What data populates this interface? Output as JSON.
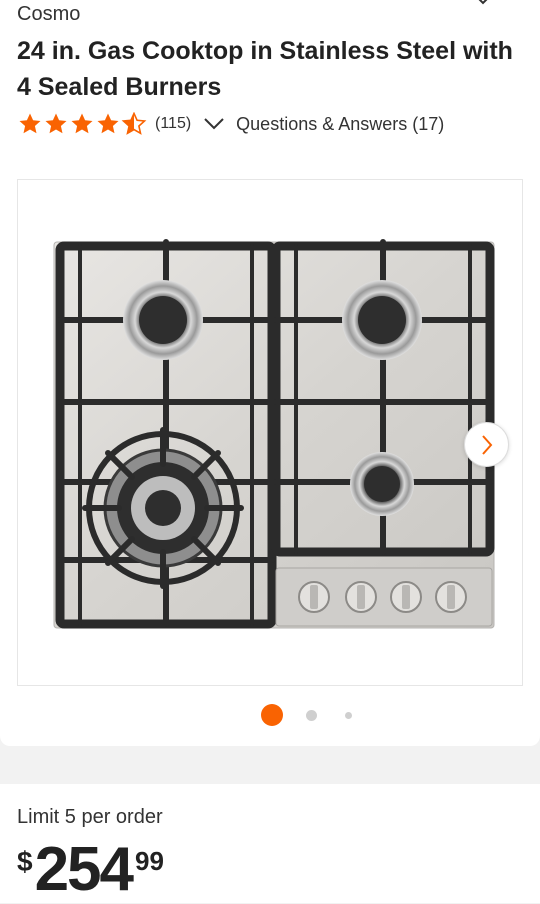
{
  "product": {
    "brand": "Cosmo",
    "title": "24 in. Gas Cooktop in Stainless Steel with 4 Sealed Burners"
  },
  "rating": {
    "stars": 4.5,
    "count_label": "(115)",
    "qa_label": "Questions & Answers (17)",
    "star_color": "#f96302"
  },
  "gallery": {
    "image_alt": "Stainless steel gas cooktop with 4 burners and cast iron grates",
    "dot_count": 3,
    "active_index": 0,
    "active_color": "#f96302"
  },
  "order": {
    "limit_label": "Limit 5 per order"
  },
  "price": {
    "currency": "$",
    "dollars": "254",
    "cents": "99"
  }
}
